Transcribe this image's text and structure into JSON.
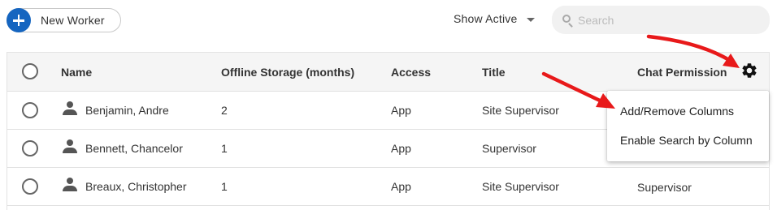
{
  "toolbar": {
    "new_worker_label": "New Worker",
    "filter_label": "Show Active",
    "search_placeholder": "Search"
  },
  "table": {
    "columns": [
      "Name",
      "Offline Storage (months)",
      "Access",
      "Title",
      "Chat Permission"
    ],
    "rows": [
      {
        "name": "Benjamin, Andre",
        "offline_storage": "2",
        "access": "App",
        "title": "Site Supervisor",
        "chat_permission": ""
      },
      {
        "name": "Bennett, Chancelor",
        "offline_storage": "1",
        "access": "App",
        "title": "Supervisor",
        "chat_permission": ""
      },
      {
        "name": "Breaux, Christopher",
        "offline_storage": "1",
        "access": "App",
        "title": "Site Supervisor",
        "chat_permission": "Supervisor"
      }
    ]
  },
  "settings_menu": {
    "items": [
      "Add/Remove Columns",
      "Enable Search by Column"
    ]
  },
  "colors": {
    "accent": "#1565c0",
    "annotation_arrow": "#e8191a",
    "header_bg": "#f5f5f5"
  },
  "icons": {
    "add": "plus-icon",
    "dropdown": "caret-down-icon",
    "search": "search-icon",
    "person": "person-icon",
    "settings": "gear-icon"
  }
}
